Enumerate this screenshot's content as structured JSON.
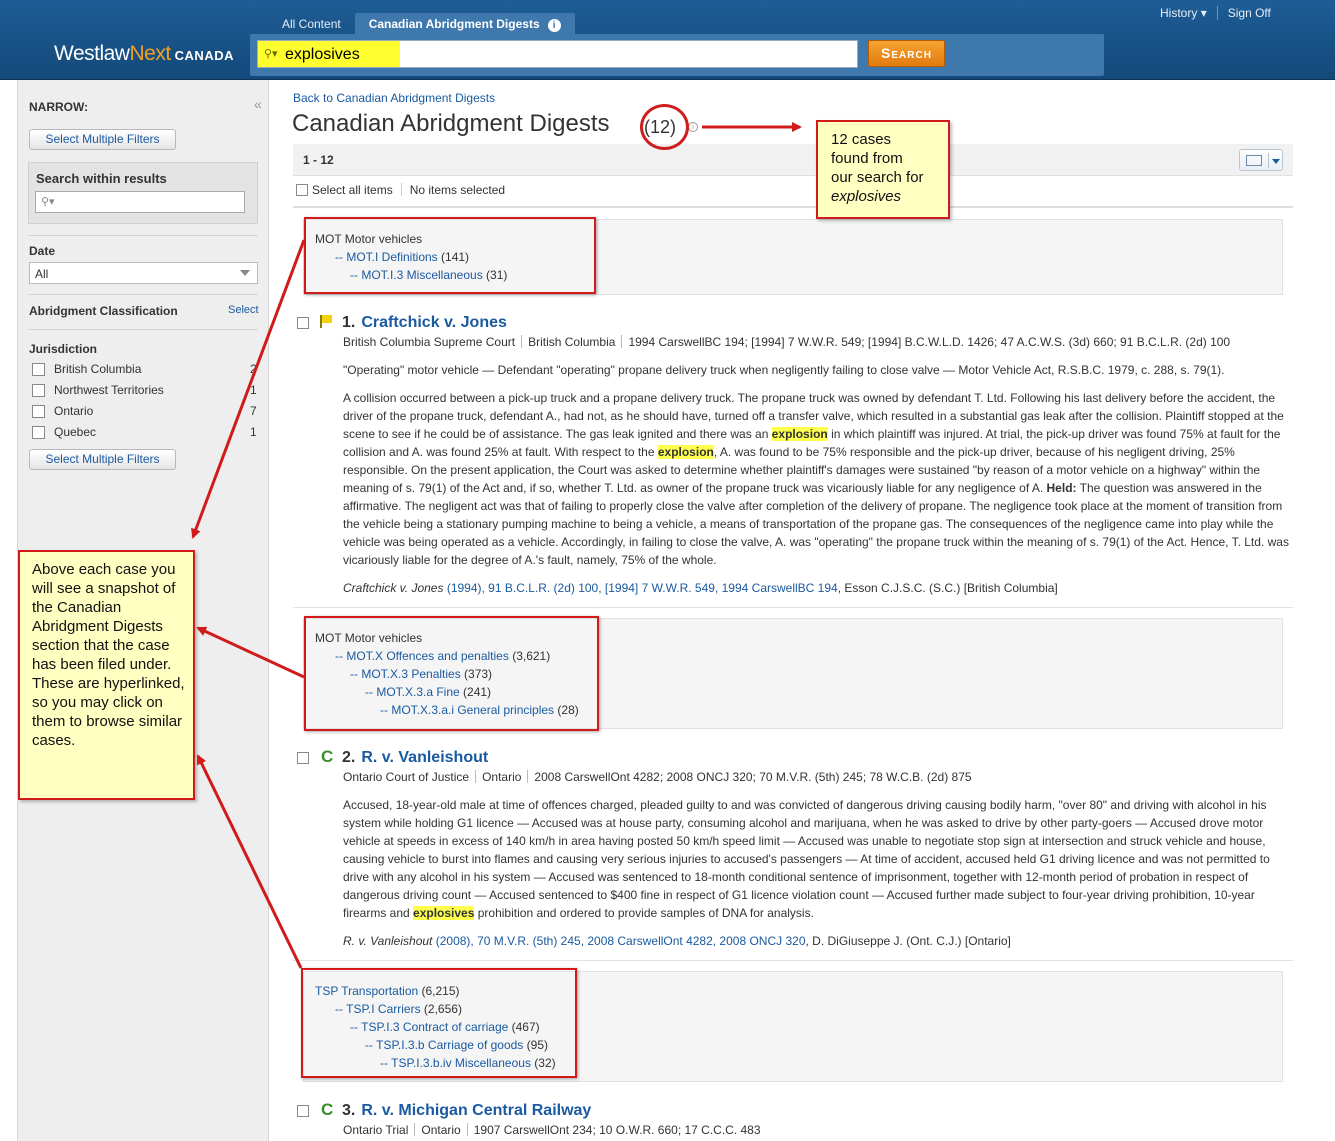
{
  "header": {
    "tabs": [
      {
        "label": "All Content"
      },
      {
        "label": "Canadian Abridgment Digests"
      }
    ],
    "logo_main": "Westlaw",
    "logo_next": "Next",
    "logo_region": "CANADA",
    "search_value": "explosives",
    "search_button": "Search",
    "history_label": "History",
    "signoff_label": "Sign Off"
  },
  "sidebar": {
    "title": "NARROW:",
    "collapse": "«",
    "select_multiple_filters": "Select Multiple Filters",
    "search_within_label": "Search within results",
    "date_label": "Date",
    "date_value": "All",
    "classification_label": "Abridgment Classification",
    "classification_select": "Select",
    "jurisdiction_label": "Jurisdiction",
    "jurisdictions": [
      {
        "name": "British Columbia",
        "count": "2"
      },
      {
        "name": "Northwest Territories",
        "count": "1"
      },
      {
        "name": "Ontario",
        "count": "7"
      },
      {
        "name": "Quebec",
        "count": "1"
      }
    ]
  },
  "main": {
    "back_link": "Back to Canadian Abridgment Digests",
    "title": "Canadian Abridgment Digests",
    "count": "(12)",
    "range": "1 - 12",
    "select_all": "Select all items",
    "no_selected": "No items selected",
    "digests": [
      {
        "lines": [
          {
            "indent": 0,
            "link": "",
            "text": "MOT Motor vehicles"
          },
          {
            "indent": 1,
            "link": "-- MOT.I Definitions",
            "text": " (141)"
          },
          {
            "indent": 2,
            "link": "-- MOT.I.3 Miscellaneous",
            "text": " (31)"
          }
        ]
      },
      {
        "lines": [
          {
            "indent": 0,
            "link": "",
            "text": "MOT Motor vehicles"
          },
          {
            "indent": 1,
            "link": "-- MOT.X Offences and penalties",
            "text": " (3,621)"
          },
          {
            "indent": 2,
            "link": "-- MOT.X.3 Penalties",
            "text": " (373)"
          },
          {
            "indent": 3,
            "link": "-- MOT.X.3.a Fine",
            "text": " (241)"
          },
          {
            "indent": 4,
            "link": "-- MOT.X.3.a.i General principles",
            "text": " (28)"
          }
        ]
      },
      {
        "lines": [
          {
            "indent": 0,
            "link": "TSP Transportation",
            "text": " (6,215)"
          },
          {
            "indent": 1,
            "link": "-- TSP.I Carriers",
            "text": " (2,656)"
          },
          {
            "indent": 2,
            "link": "-- TSP.I.3 Contract of carriage",
            "text": " (467)"
          },
          {
            "indent": 3,
            "link": "-- TSP.I.3.b Carriage of goods",
            "text": " (95)"
          },
          {
            "indent": 4,
            "link": "-- TSP.I.3.b.iv Miscellaneous",
            "text": " (32)"
          }
        ]
      }
    ],
    "cases": [
      {
        "number": "1.",
        "title": "Craftchick v. Jones",
        "court": "British Columbia Supreme Court",
        "jurisdiction": "British Columbia",
        "citations": "1994 CarswellBC 194; [1994] 7 W.W.R. 549; [1994] B.C.W.L.D. 1426; 47 A.C.W.S. (3d) 660; 91 B.C.L.R. (2d) 100",
        "headnote": "\"Operating\" motor vehicle — Defendant \"operating\" propane delivery truck when negligently failing to close valve — Motor Vehicle Act, R.S.B.C. 1979, c. 288, s. 79(1).",
        "summary": [
          "A collision occurred between a pick-up truck and a propane delivery truck. The propane truck was owned by defendant T. Ltd. Following his last delivery before the accident, the driver of the propane truck, defendant A., had not, as he should have, turned off a transfer valve, which resulted in a substantial gas leak after the collision. Plaintiff stopped at the scene to see if he could be of assistance. The gas leak ignited and there was an ",
          "explosion",
          " in which plaintiff was injured. At trial, the pick-up driver was found 75% at fault for the collision and A. was found 25% at fault. With respect to the ",
          "explosion",
          ", A. was found to be 75% responsible and the pick-up driver, because of his negligent driving, 25% responsible. On the present application, the Court was asked to determine whether plaintiff's damages were sustained \"by reason of a motor vehicle on a highway\" within the meaning of s. 79(1) of the Act and, if so, whether T. Ltd. as owner of the propane truck was vicariously liable for any negligence of A. ",
          "Held:",
          " The question was answered in the affirmative. The negligent act was that of failing to properly close the valve after completion of the delivery of propane. The negligence took place at the moment of transition from the vehicle being a stationary pumping machine to being a vehicle, a means of transportation of the propane gas. The consequences of the negligence came into play while the vehicle was being operated as a vehicle. Accordingly, in failing to close the valve, A. was \"operating\" the propane truck within the meaning of s. 79(1) of the Act. Hence, T. Ltd. was vicariously liable for the degree of A.'s fault, namely, 75% of the whole."
        ],
        "cite_name": "Craftchick v. Jones",
        "cite_links": " (1994), 91 B.C.L.R. (2d) 100, [1994] 7 W.W.R. 549, 1994 CarswellBC 194",
        "cite_tail": ", Esson C.J.S.C. (S.C.) [British Columbia]"
      },
      {
        "number": "2.",
        "title": "R. v. Vanleishout",
        "court": "Ontario Court of Justice",
        "jurisdiction": "Ontario",
        "citations": "2008 CarswellOnt 4282; 2008 ONCJ 320; 70 M.V.R. (5th) 245; 78 W.C.B. (2d) 875",
        "summary": [
          "Accused, 18-year-old male at time of offences charged, pleaded guilty to and was convicted of dangerous driving causing bodily harm, \"over 80\" and driving with alcohol in his system while holding G1 licence — Accused was at house party, consuming alcohol and marijuana, when he was asked to drive by other party-goers — Accused drove motor vehicle at speeds in excess of 140 km/h in area having posted 50 km/h speed limit — Accused was unable to negotiate stop sign at intersection and struck vehicle and house, causing vehicle to burst into flames and causing very serious injuries to accused's passengers — At time of accident, accused held G1 driving licence and was not permitted to drive with any alcohol in his system — Accused was sentenced to 18-month conditional sentence of imprisonment, together with 12-month period of probation in respect of dangerous driving count — Accused sentenced to $400 fine in respect of G1 licence violation count — Accused further made subject to four-year driving prohibition, 10-year firearms and ",
          "explosives",
          " prohibition and ordered to provide samples of DNA for analysis."
        ],
        "cite_name": "R. v. Vanleishout",
        "cite_links": " (2008), 70 M.V.R. (5th) 245, 2008 CarswellOnt 4282, 2008 ONCJ 320",
        "cite_tail": ", D. DiGiuseppe J. (Ont. C.J.) [Ontario]"
      },
      {
        "number": "3.",
        "title": "R. v. Michigan Central Railway",
        "court": "Ontario Trial",
        "jurisdiction": "Ontario",
        "citations": "1907 CarswellOnt 234; 10 O.W.R. 660; 17 C.C.C. 483"
      }
    ]
  },
  "callouts": {
    "count_note": [
      "12 cases",
      "found from",
      "our search for",
      "explosives"
    ],
    "digest_note": "Above each case you will see a snapshot of the Canadian Abridgment Digests section that the case has been filed under. These are hyperlinked, so you may click on them to browse similar cases."
  },
  "colors": {
    "header_blue": "#1e5d96",
    "accent_orange": "#f3a21f",
    "link_blue": "#1b5aa0",
    "annotation_red": "#d11b1b",
    "callout_yellow": "#ffffc2",
    "highlight_yellow": "#ffff4d"
  }
}
